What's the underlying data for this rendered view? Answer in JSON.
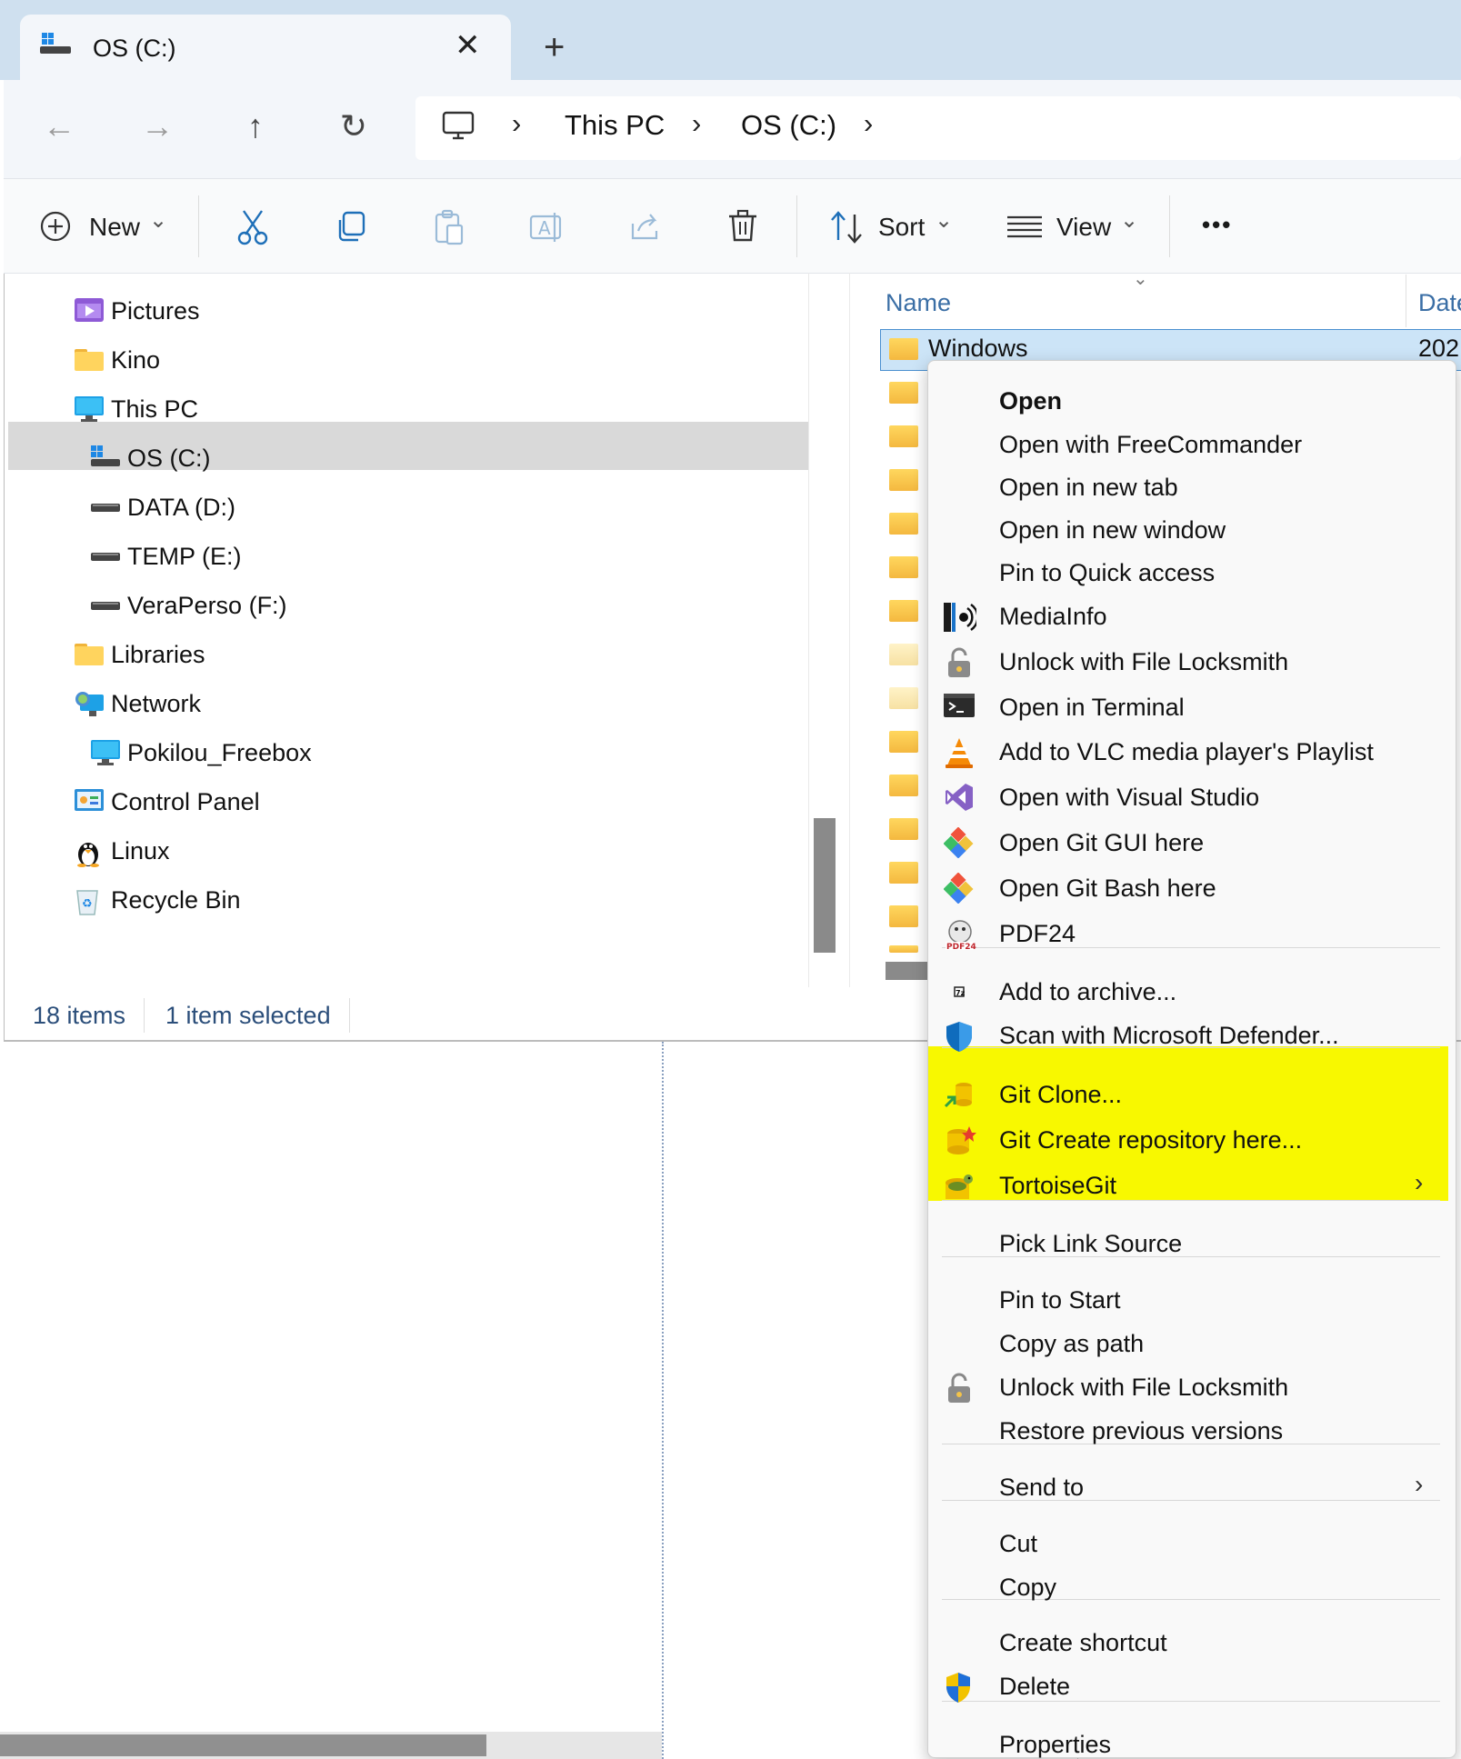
{
  "tab": {
    "title": "OS (C:)",
    "close": "✕",
    "add": "+"
  },
  "nav": {
    "back": "←",
    "forward": "→",
    "up": "↑",
    "refresh": "↻"
  },
  "address": {
    "crumbs": [
      "This PC",
      "OS (C:)"
    ],
    "sep": "›"
  },
  "toolbar": {
    "new_label": "New",
    "sort_label": "Sort",
    "view_label": "View",
    "more_label": "•••",
    "dropdown": "⌄"
  },
  "sidebar": {
    "items": [
      {
        "label": "Pictures",
        "icon": "pictures-icon"
      },
      {
        "label": "Kino",
        "icon": "folder-icon"
      },
      {
        "label": "This PC",
        "icon": "computer-icon"
      },
      {
        "label": "OS (C:)",
        "icon": "windows-drive-icon",
        "selected": true
      },
      {
        "label": "DATA (D:)",
        "icon": "drive-icon"
      },
      {
        "label": "TEMP (E:)",
        "icon": "drive-icon"
      },
      {
        "label": "VeraPerso (F:)",
        "icon": "drive-icon"
      },
      {
        "label": "Libraries",
        "icon": "folder-icon"
      },
      {
        "label": "Network",
        "icon": "network-icon"
      },
      {
        "label": "Pokilou_Freebox",
        "icon": "computer-icon"
      },
      {
        "label": "Control Panel",
        "icon": "control-panel-icon"
      },
      {
        "label": "Linux",
        "icon": "penguin-icon"
      },
      {
        "label": "Recycle Bin",
        "icon": "recycle-bin-icon"
      }
    ]
  },
  "list": {
    "col_name": "Name",
    "col_date": "Date",
    "selected_row": {
      "name": "Windows",
      "date": "202"
    }
  },
  "status": {
    "items": "18 items",
    "selected": "1 item selected"
  },
  "menu": {
    "items": [
      {
        "label": "Open",
        "icon": "",
        "bold": true
      },
      {
        "label": "Open with FreeCommander",
        "icon": ""
      },
      {
        "label": "Open in new tab",
        "icon": ""
      },
      {
        "label": "Open in new window",
        "icon": ""
      },
      {
        "label": "Pin to Quick access",
        "icon": ""
      },
      {
        "label": "MediaInfo",
        "icon": "mediainfo-icon"
      },
      {
        "label": "Unlock with File Locksmith",
        "icon": "lock-icon"
      },
      {
        "label": "Open in Terminal",
        "icon": "terminal-icon"
      },
      {
        "label": "Add to VLC media player's Playlist",
        "icon": "vlc-icon"
      },
      {
        "label": "Open with Visual Studio",
        "icon": "visual-studio-icon"
      },
      {
        "label": "Open Git GUI here",
        "icon": "git-icon"
      },
      {
        "label": "Open Git Bash here",
        "icon": "git-icon"
      },
      {
        "label": "PDF24",
        "icon": "pdf24-icon"
      },
      {
        "label": "Add to archive...",
        "icon": "archive-icon"
      },
      {
        "label": "Scan with Microsoft Defender...",
        "icon": "defender-shield-icon"
      },
      {
        "label": "Git Clone...",
        "icon": "tortoisegit-clone-icon"
      },
      {
        "label": "Git Create repository here...",
        "icon": "tortoisegit-create-icon"
      },
      {
        "label": "TortoiseGit",
        "icon": "tortoisegit-icon",
        "submenu": true
      },
      {
        "label": "Pick Link Source",
        "icon": ""
      },
      {
        "label": "Pin to Start",
        "icon": ""
      },
      {
        "label": "Copy as path",
        "icon": ""
      },
      {
        "label": "Unlock with File Locksmith",
        "icon": "lock-icon"
      },
      {
        "label": "Restore previous versions",
        "icon": ""
      },
      {
        "label": "Send to",
        "icon": "",
        "submenu": true
      },
      {
        "label": "Cut",
        "icon": ""
      },
      {
        "label": "Copy",
        "icon": ""
      },
      {
        "label": "Create shortcut",
        "icon": ""
      },
      {
        "label": "Delete",
        "icon": "uac-shield-icon"
      },
      {
        "label": "Properties",
        "icon": ""
      }
    ],
    "submenu_arrow": "›",
    "highlight_color": "#f8f800"
  }
}
